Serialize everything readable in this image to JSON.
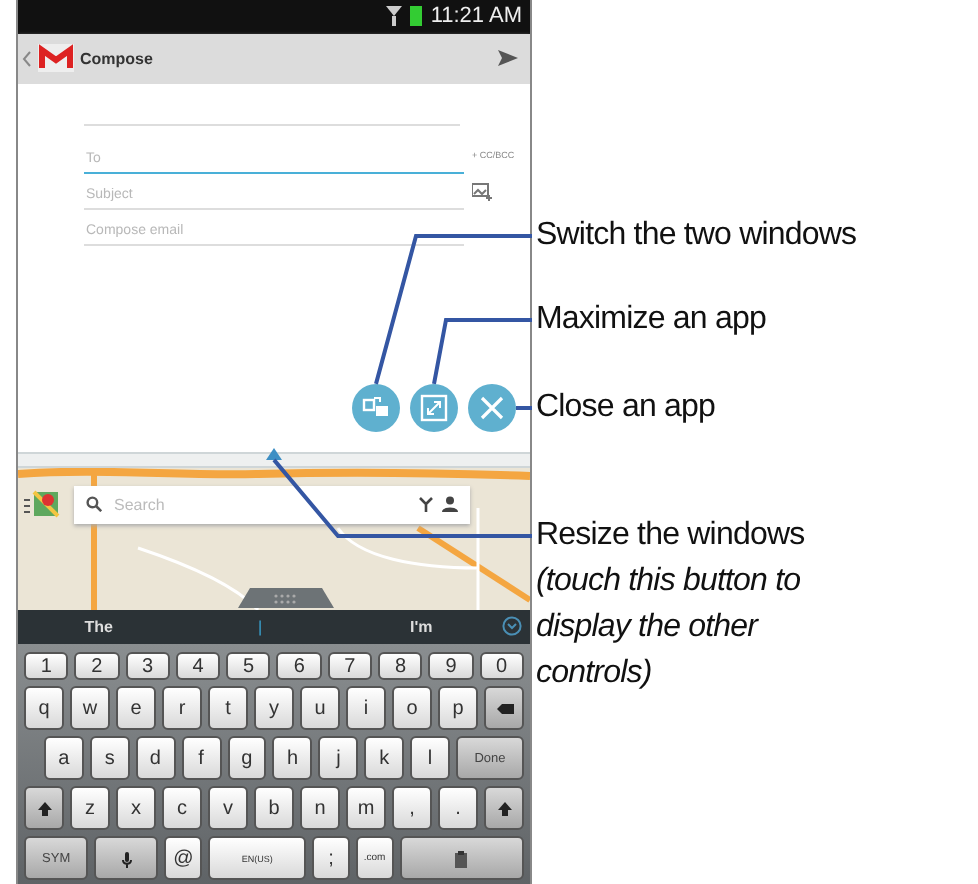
{
  "status_bar": {
    "time": "11:21 AM"
  },
  "action_bar": {
    "title": "Compose"
  },
  "compose": {
    "fields": [
      {
        "placeholder": "To",
        "focused": true,
        "extra": "+ CC/BCC"
      },
      {
        "placeholder": "Subject",
        "focused": false
      },
      {
        "placeholder": "Compose email",
        "focused": false
      }
    ]
  },
  "window_controls": [
    {
      "kind": "switch"
    },
    {
      "kind": "maximize"
    },
    {
      "kind": "close"
    }
  ],
  "map": {
    "search": {
      "placeholder": "Search"
    }
  },
  "keyboard": {
    "suggestions": [
      {
        "kind": "word",
        "text": "The"
      },
      {
        "kind": "cursor",
        "text": "|"
      },
      {
        "kind": "word",
        "text": "I'm"
      }
    ],
    "rows": [
      [
        {
          "kind": "char",
          "label": "1"
        },
        {
          "kind": "char",
          "label": "2"
        },
        {
          "kind": "char",
          "label": "3"
        },
        {
          "kind": "char",
          "label": "4"
        },
        {
          "kind": "char",
          "label": "5"
        },
        {
          "kind": "char",
          "label": "6"
        },
        {
          "kind": "char",
          "label": "7"
        },
        {
          "kind": "char",
          "label": "8"
        },
        {
          "kind": "char",
          "label": "9"
        },
        {
          "kind": "char",
          "label": "0"
        }
      ],
      [
        {
          "kind": "char",
          "label": "q"
        },
        {
          "kind": "char",
          "label": "w"
        },
        {
          "kind": "char",
          "label": "e"
        },
        {
          "kind": "char",
          "label": "r"
        },
        {
          "kind": "char",
          "label": "t"
        },
        {
          "kind": "char",
          "label": "y"
        },
        {
          "kind": "char",
          "label": "u"
        },
        {
          "kind": "char",
          "label": "i"
        },
        {
          "kind": "char",
          "label": "o"
        },
        {
          "kind": "char",
          "label": "p"
        },
        {
          "kind": "backspace"
        }
      ],
      [
        {
          "kind": "char",
          "label": "a"
        },
        {
          "kind": "char",
          "label": "s"
        },
        {
          "kind": "char",
          "label": "d"
        },
        {
          "kind": "char",
          "label": "f"
        },
        {
          "kind": "char",
          "label": "g"
        },
        {
          "kind": "char",
          "label": "h"
        },
        {
          "kind": "char",
          "label": "j"
        },
        {
          "kind": "char",
          "label": "k"
        },
        {
          "kind": "char",
          "label": "l"
        },
        {
          "kind": "action",
          "label": "Done"
        }
      ],
      [
        {
          "kind": "shift"
        },
        {
          "kind": "char",
          "label": "z"
        },
        {
          "kind": "char",
          "label": "x"
        },
        {
          "kind": "char",
          "label": "c"
        },
        {
          "kind": "char",
          "label": "v"
        },
        {
          "kind": "char",
          "label": "b"
        },
        {
          "kind": "char",
          "label": "n"
        },
        {
          "kind": "char",
          "label": "m"
        },
        {
          "kind": "char",
          "label": ","
        },
        {
          "kind": "char",
          "label": "."
        },
        {
          "kind": "shift"
        }
      ],
      [
        {
          "kind": "action",
          "label": "SYM"
        },
        {
          "kind": "mic"
        },
        {
          "kind": "char",
          "label": "@"
        },
        {
          "kind": "space",
          "label": "EN(US)"
        },
        {
          "kind": "char",
          "label": ";"
        },
        {
          "kind": "small",
          "label": ".com"
        },
        {
          "kind": "clipboard"
        }
      ]
    ]
  },
  "callouts": [
    {
      "kind": "switch",
      "text": "Switch the two windows"
    },
    {
      "kind": "maximize",
      "text": "Maximize an app"
    },
    {
      "kind": "close",
      "text": "Close an app"
    },
    {
      "kind": "resize",
      "text": "Resize the windows",
      "note": "(touch this button to display the other controls)"
    }
  ]
}
